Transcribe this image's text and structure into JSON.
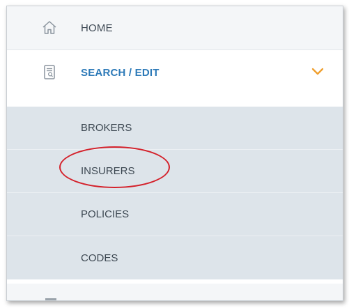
{
  "menu": {
    "home": {
      "label": "HOME",
      "icon": "home-icon"
    },
    "search_edit": {
      "label": "SEARCH / EDIT",
      "icon": "search-document-icon",
      "expanded": true,
      "chevron_icon": "chevron-down-icon"
    },
    "submenu": [
      {
        "label": "BROKERS"
      },
      {
        "label": "INSURERS",
        "highlighted": true
      },
      {
        "label": "POLICIES"
      },
      {
        "label": "CODES"
      }
    ]
  },
  "colors": {
    "active_text": "#2d7ab8",
    "chevron": "#f0a030",
    "submenu_bg": "#dde4ea",
    "highlight_annotation": "#d4202a"
  }
}
